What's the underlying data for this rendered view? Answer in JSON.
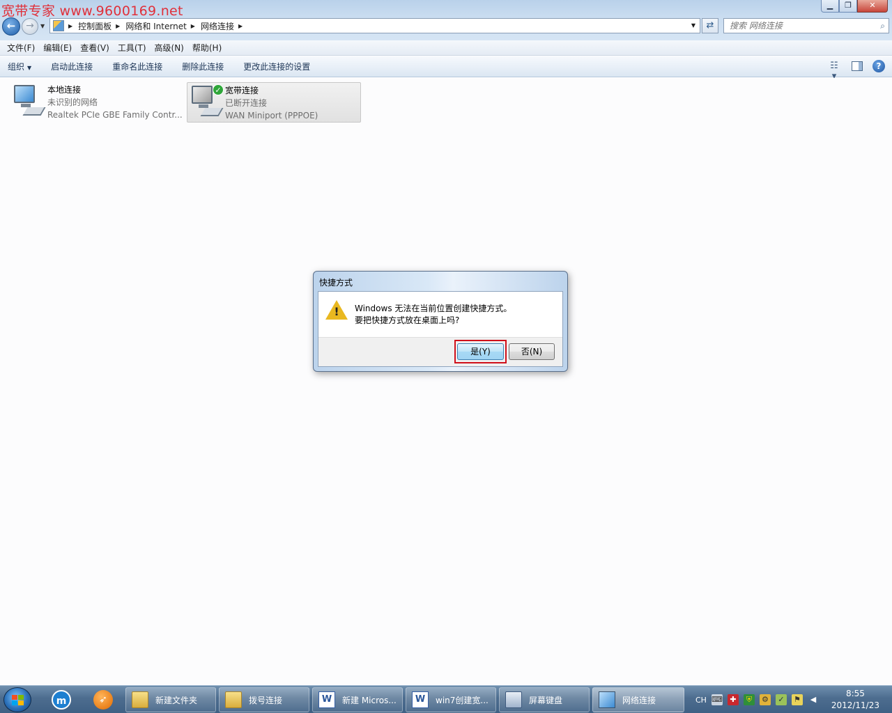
{
  "watermark": "宽带专家 www.9600169.net",
  "window": {
    "min_glyph": "▁",
    "max_glyph": "❐",
    "close_glyph": "✕"
  },
  "address": {
    "crumbs": [
      "控制面板",
      "网络和 Internet",
      "网络连接"
    ]
  },
  "search": {
    "placeholder": "搜索 网络连接"
  },
  "menu": [
    "文件(F)",
    "编辑(E)",
    "查看(V)",
    "工具(T)",
    "高级(N)",
    "帮助(H)"
  ],
  "commands": {
    "organize": "组织",
    "items": [
      "启动此连接",
      "重命名此连接",
      "删除此连接",
      "更改此连接的设置"
    ]
  },
  "connections": [
    {
      "name": "本地连接",
      "status": "未识别的网络",
      "device": "Realtek PCIe GBE Family Contr..."
    },
    {
      "name": "宽带连接",
      "status": "已断开连接",
      "device": "WAN Miniport (PPPOE)"
    }
  ],
  "dialog": {
    "title": "快捷方式",
    "line1": "Windows 无法在当前位置创建快捷方式。",
    "line2": "要把快捷方式放在桌面上吗?",
    "yes": "是(Y)",
    "no": "否(N)"
  },
  "taskbar": {
    "tasks": [
      "新建文件夹",
      "拨号连接",
      "新建 Micros...",
      "win7创建宽...",
      "屏幕键盘",
      "网络连接"
    ],
    "ime": "CH",
    "time": "8:55",
    "date": "2012/11/23"
  }
}
